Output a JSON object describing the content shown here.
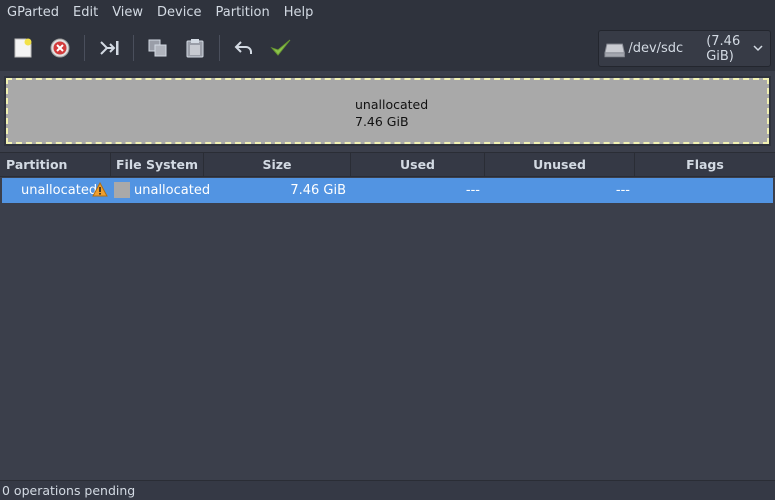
{
  "menubar": [
    "GParted",
    "Edit",
    "View",
    "Device",
    "Partition",
    "Help"
  ],
  "toolbar": {
    "buttons": [
      "new-partition",
      "delete-partition",
      "resize-move",
      "copy",
      "paste",
      "undo",
      "apply"
    ]
  },
  "device": {
    "name": "/dev/sdc",
    "size": "(7.46 GiB)"
  },
  "disk_visual": {
    "label": "unallocated",
    "size": "7.46 GiB"
  },
  "table": {
    "headers": [
      "Partition",
      "File System",
      "Size",
      "Used",
      "Unused",
      "Flags"
    ],
    "rows": [
      {
        "partition": "unallocated",
        "filesystem": "unallocated",
        "size": "7.46 GiB",
        "used": "---",
        "unused": "---",
        "flags": ""
      }
    ]
  },
  "status": "0 operations pending",
  "colors": {
    "selection": "#5294e2",
    "unallocated": "#a9a9a9",
    "warning": "#f0a030",
    "apply": "#8bc34a"
  }
}
